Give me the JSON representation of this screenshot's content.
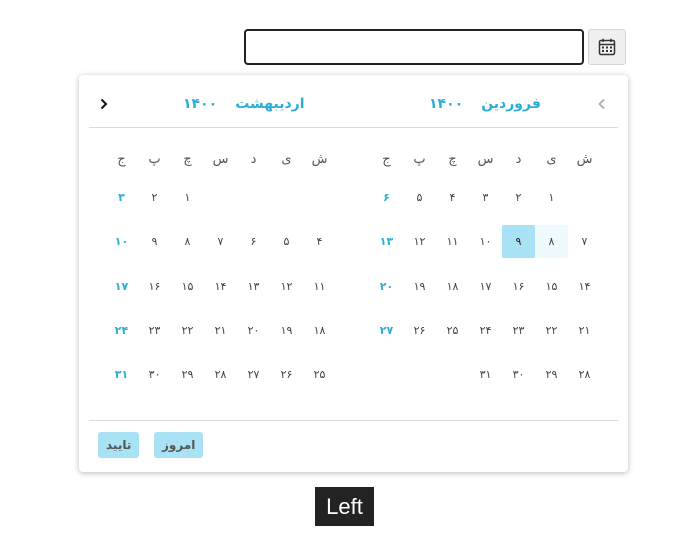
{
  "calendar_button": {
    "icon": "calendar-icon"
  },
  "date_input": {
    "value": "",
    "placeholder": ""
  },
  "popup": {
    "prev_icon": "chevron-left-icon",
    "next_icon": "chevron-right-icon",
    "months": [
      {
        "name": "فروردین",
        "year": "۱۴۰۰",
        "weekdays": [
          "ش",
          "ی",
          "د",
          "س",
          "چ",
          "پ",
          "ج"
        ],
        "lead_blanks": 1,
        "days": [
          "۱",
          "۲",
          "۳",
          "۴",
          "۵",
          "۶",
          "۷",
          "۸",
          "۹",
          "۱۰",
          "۱۱",
          "۱۲",
          "۱۳",
          "۱۴",
          "۱۵",
          "۱۶",
          "۱۷",
          "۱۸",
          "۱۹",
          "۲۰",
          "۲۱",
          "۲۲",
          "۲۳",
          "۲۴",
          "۲۵",
          "۲۶",
          "۲۷",
          "۲۸",
          "۲۹",
          "۳۰",
          "۳۱"
        ],
        "selected": "۹",
        "hovered": "۸"
      },
      {
        "name": "اردیبهشت",
        "year": "۱۴۰۰",
        "weekdays": [
          "ش",
          "ی",
          "د",
          "س",
          "چ",
          "پ",
          "ج"
        ],
        "lead_blanks": 4,
        "days": [
          "۱",
          "۲",
          "۳",
          "۴",
          "۵",
          "۶",
          "۷",
          "۸",
          "۹",
          "۱۰",
          "۱۱",
          "۱۲",
          "۱۳",
          "۱۴",
          "۱۵",
          "۱۶",
          "۱۷",
          "۱۸",
          "۱۹",
          "۲۰",
          "۲۱",
          "۲۲",
          "۲۳",
          "۲۴",
          "۲۵",
          "۲۶",
          "۲۷",
          "۲۸",
          "۲۹",
          "۳۰",
          "۳۱"
        ],
        "selected": "",
        "hovered": ""
      }
    ],
    "today_label": "امروز",
    "confirm_label": "تایید",
    "accent_color": "#2aaed6",
    "selected_color": "#a9e2f5"
  },
  "caption": "Left"
}
